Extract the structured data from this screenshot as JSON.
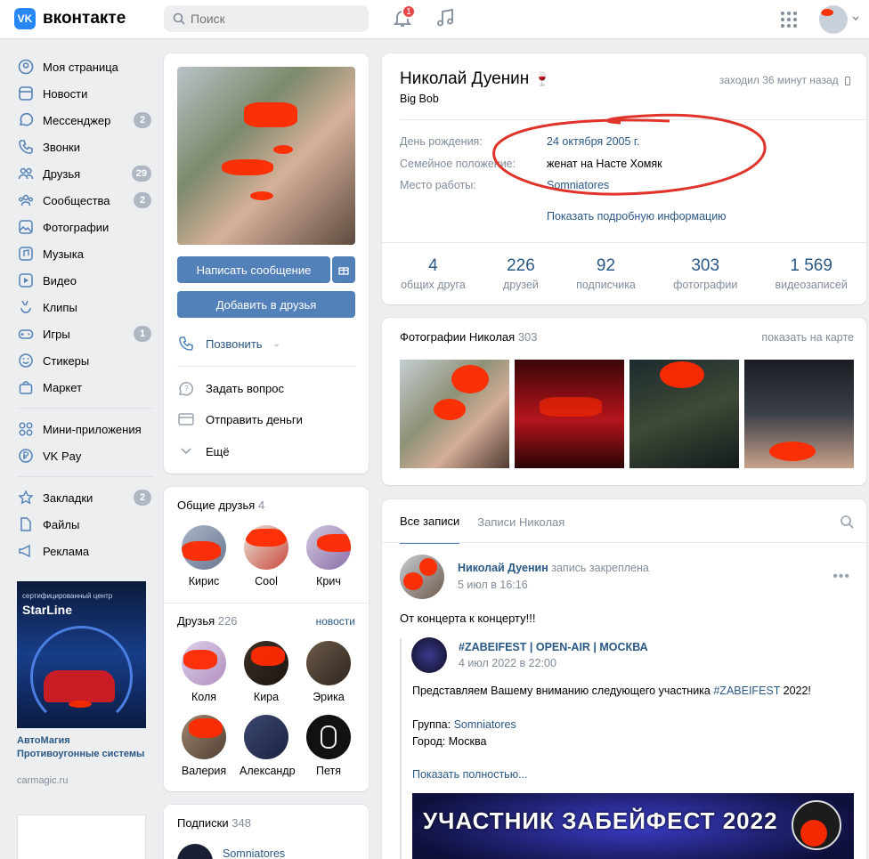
{
  "header": {
    "logo_text": "вконтакте",
    "logo_mark": "VK",
    "search_placeholder": "Поиск",
    "notifications_count": "1"
  },
  "sidebar": {
    "items": [
      {
        "label": "Моя страница",
        "icon": "user-circle-icon",
        "count": ""
      },
      {
        "label": "Новости",
        "icon": "news-icon",
        "count": ""
      },
      {
        "label": "Мессенджер",
        "icon": "chat-icon",
        "count": "2"
      },
      {
        "label": "Звонки",
        "icon": "phone-icon",
        "count": ""
      },
      {
        "label": "Друзья",
        "icon": "friends-icon",
        "count": "29"
      },
      {
        "label": "Сообщества",
        "icon": "communities-icon",
        "count": "2"
      },
      {
        "label": "Фотографии",
        "icon": "photo-icon",
        "count": ""
      },
      {
        "label": "Музыка",
        "icon": "music-icon",
        "count": ""
      },
      {
        "label": "Видео",
        "icon": "video-icon",
        "count": ""
      },
      {
        "label": "Клипы",
        "icon": "clips-icon",
        "count": ""
      },
      {
        "label": "Игры",
        "icon": "gamepad-icon",
        "count": "1"
      },
      {
        "label": "Стикеры",
        "icon": "smile-icon",
        "count": ""
      },
      {
        "label": "Маркет",
        "icon": "bag-icon",
        "count": ""
      }
    ],
    "items2": [
      {
        "label": "Мини-приложения",
        "icon": "apps-icon"
      },
      {
        "label": "VK Pay",
        "icon": "ruble-icon"
      }
    ],
    "items3": [
      {
        "label": "Закладки",
        "icon": "star-icon",
        "count": "2"
      },
      {
        "label": "Файлы",
        "icon": "file-icon",
        "count": ""
      },
      {
        "label": "Реклама",
        "icon": "megaphone-icon",
        "count": ""
      }
    ],
    "ad": {
      "small_text": "сертифицированный центр",
      "brand": "StarLine",
      "title": "АвтоМагия Противоугонные системы",
      "url": "carmagic.ru"
    }
  },
  "profile_actions": {
    "write_message": "Написать сообщение",
    "add_friend": "Добавить в друзья",
    "call": "Позвонить",
    "ask_question": "Задать вопрос",
    "send_money": "Отправить деньги",
    "more": "Ещё"
  },
  "mutual": {
    "title": "Общие друзья",
    "count": "4",
    "friends": [
      "Кирис",
      "Cool",
      "Крич"
    ]
  },
  "friends": {
    "title": "Друзья",
    "count": "226",
    "news_link": "новости",
    "items": [
      "Коля",
      "Кира",
      "Эрика",
      "Валерия",
      "Александр",
      "Петя"
    ]
  },
  "subscriptions": {
    "title": "Подписки",
    "count": "348",
    "first": "Somniatores"
  },
  "profile": {
    "name": "Николай Дуенин",
    "status": "Big Bob",
    "last_seen": "заходил 36 минут назад",
    "rows": [
      {
        "key": "День рождения:",
        "value": "24 октября 2005 г."
      },
      {
        "key": "Семейное положение:",
        "value": "женат на Насте Хомяк"
      },
      {
        "key": "Место работы:",
        "value": "Somniatores"
      }
    ],
    "more_info": "Показать подробную информацию",
    "counters": [
      {
        "n": "4",
        "l": "общих друга"
      },
      {
        "n": "226",
        "l": "друзей"
      },
      {
        "n": "92",
        "l": "подписчика"
      },
      {
        "n": "303",
        "l": "фотографии"
      },
      {
        "n": "1 569",
        "l": "видеозаписей"
      }
    ]
  },
  "photos": {
    "title": "Фотографии Николая",
    "count": "303",
    "map_link": "показать на карте"
  },
  "wall": {
    "tabs": [
      "Все записи",
      "Записи Николая"
    ],
    "post": {
      "author": "Николай Дуенин",
      "pinned": "запись закреплена",
      "date": "5 июл в 16:16",
      "text": "От концерта к концерту!!!",
      "repost": {
        "source": "#ZABEIFEST | OPEN-AIR | МОСКВА",
        "date": "4 июл 2022 в 22:00",
        "text1_prefix": "Представляем Вашему вниманию следующего участника ",
        "text1_tag": "#ZABEIFEST",
        "text1_suffix": " 2022!",
        "group_label": "Группа: ",
        "group_value": "Somniatores",
        "city": "Город: Москва",
        "show_more": "Показать полностью...",
        "banner_text": "УЧАСТНИК ЗАБЕЙФЕСТ 2022"
      }
    }
  },
  "colors": {
    "accent": "#5181b8",
    "link": "#2a5885",
    "badge_red": "#e64646",
    "bg": "#edeef0"
  }
}
